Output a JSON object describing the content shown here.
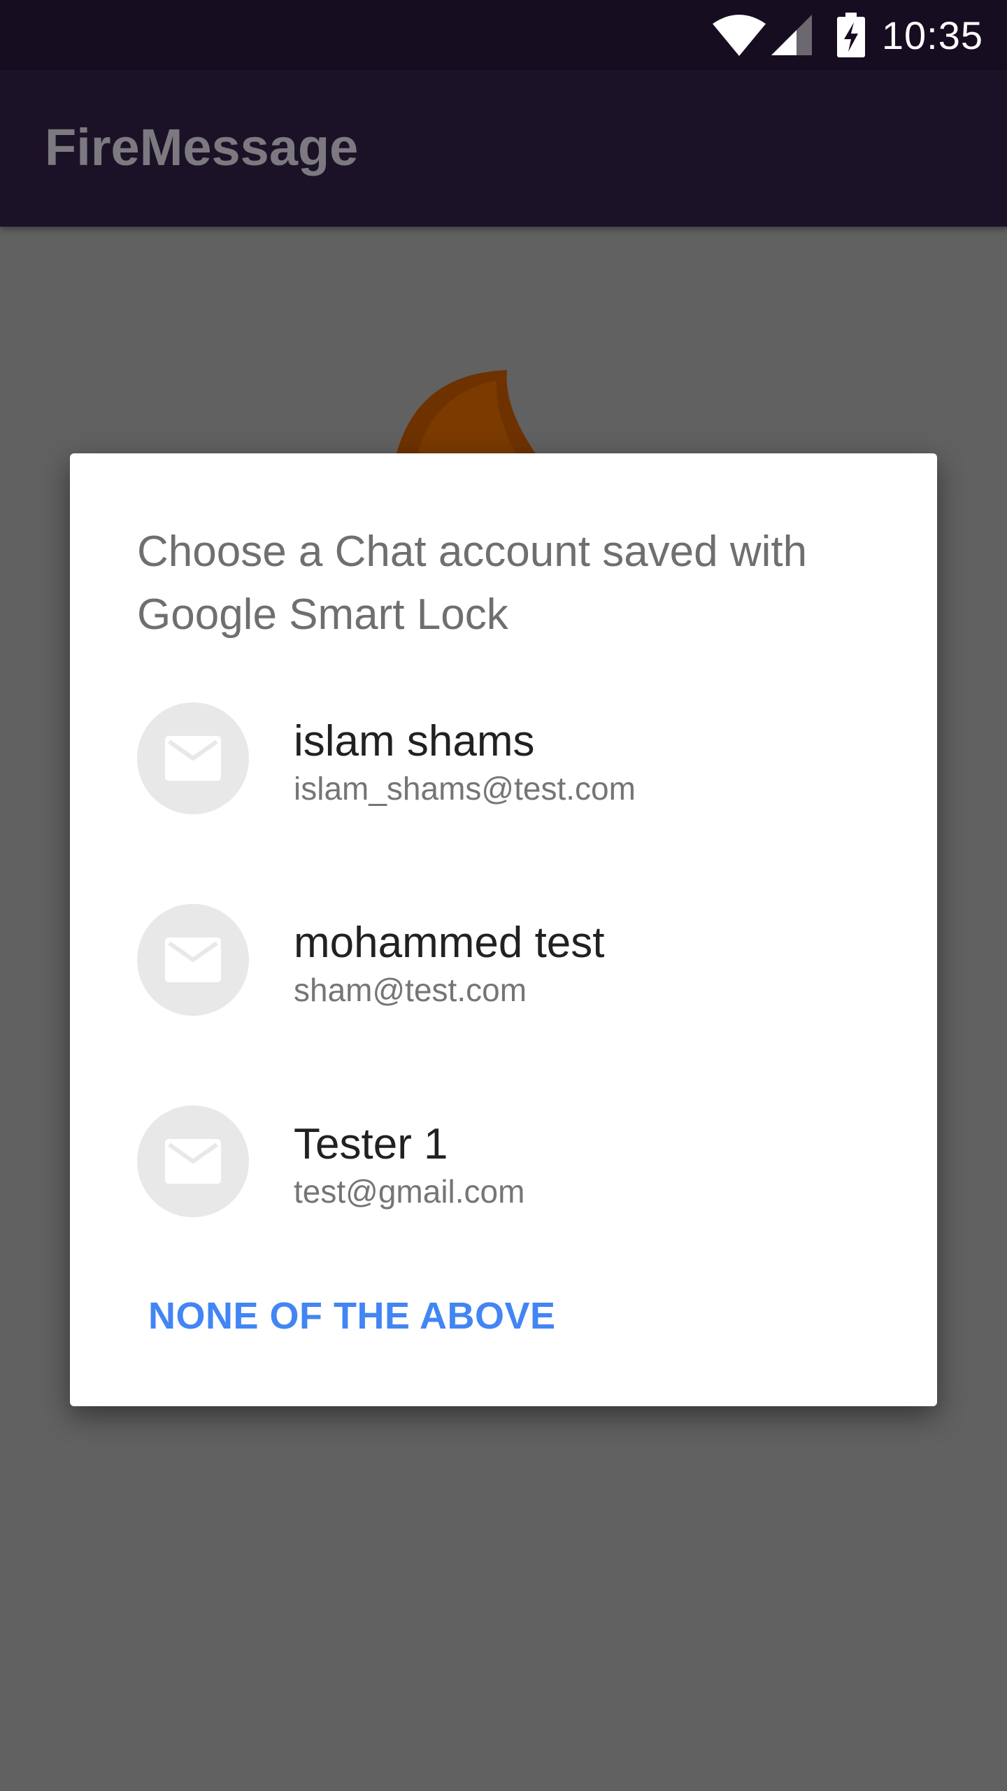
{
  "status_bar": {
    "time": "10:35",
    "icons": [
      "wifi-icon",
      "signal-icon",
      "battery-charging-icon"
    ]
  },
  "app_bar": {
    "title": "FireMessage"
  },
  "background": {
    "logo_icon": "flame-logo",
    "scrim_color": "#616161"
  },
  "dialog": {
    "title": "Choose a Chat account saved with Google Smart Lock",
    "accounts": [
      {
        "name": "islam shams",
        "email": "islam_shams@test.com",
        "icon": "mail-icon"
      },
      {
        "name": "mohammed test",
        "email": "sham@test.com",
        "icon": "mail-icon"
      },
      {
        "name": "Tester 1",
        "email": "test@gmail.com",
        "icon": "mail-icon"
      }
    ],
    "none_label": "NONE OF THE ABOVE"
  },
  "colors": {
    "status_bar": "#160d20",
    "app_bar": "#1c1228",
    "accent": "#4285f4",
    "flame": "#6e3200"
  }
}
